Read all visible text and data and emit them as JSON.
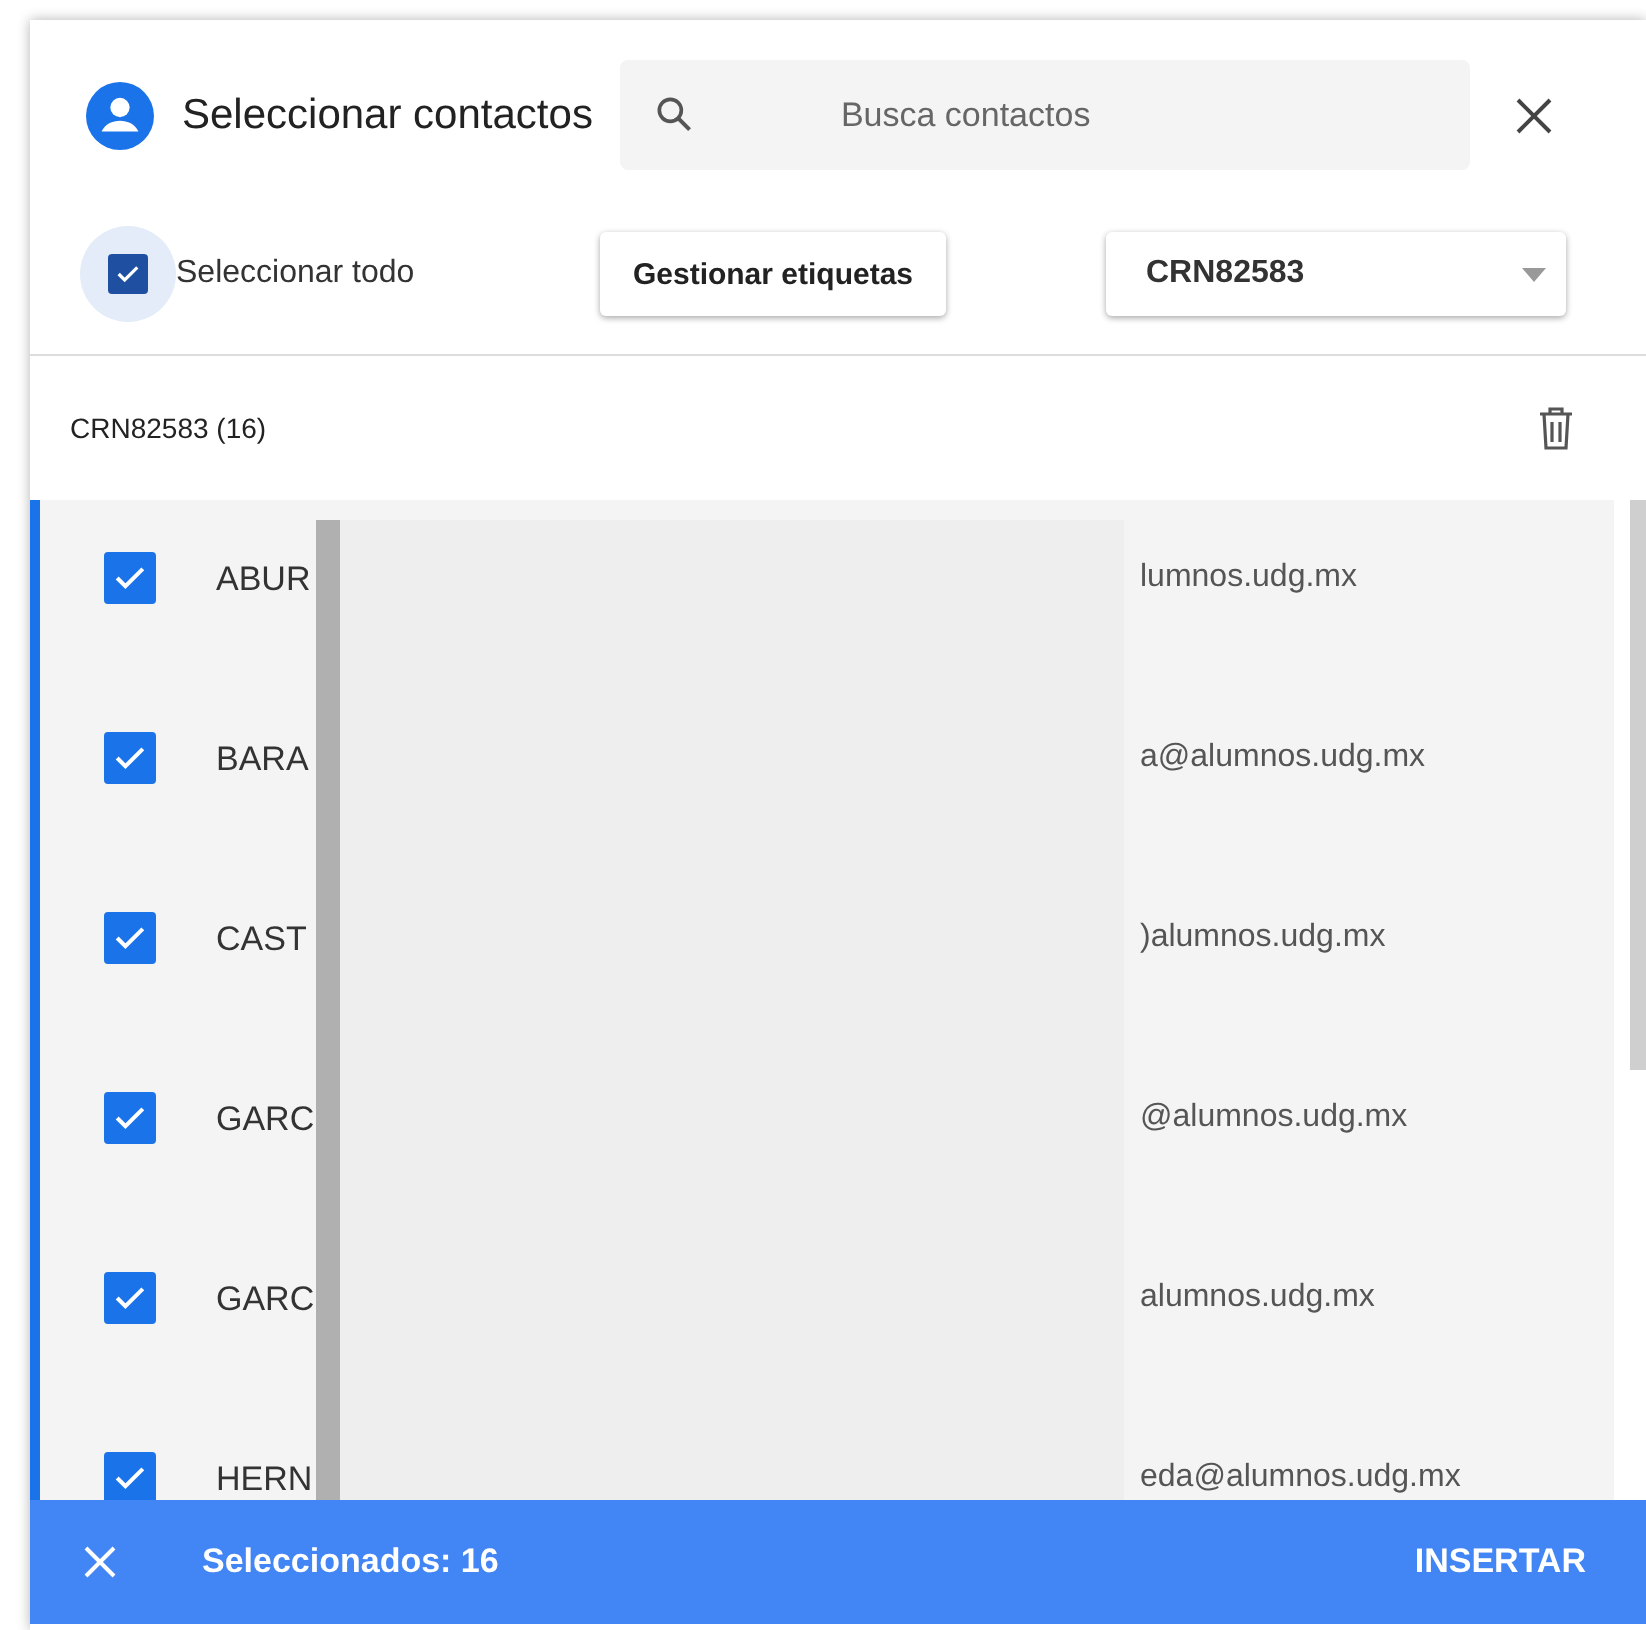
{
  "dialog": {
    "title": "Seleccionar contactos",
    "search": {
      "placeholder": "Busca contactos"
    }
  },
  "toolbar": {
    "select_all": {
      "label": "Seleccionar todo",
      "checked": true
    },
    "manage_labels": "Gestionar etiquetas",
    "label_select": "CRN82583"
  },
  "group": {
    "title": "CRN82583 (16)"
  },
  "contacts": [
    {
      "name": "ABUR",
      "email": "lumnos.udg.mx",
      "checked": true
    },
    {
      "name": "BARA",
      "email": "a@alumnos.udg.mx",
      "checked": true
    },
    {
      "name": "CAST",
      "email": ")alumnos.udg.mx",
      "checked": true
    },
    {
      "name": "GARC",
      "email": "@alumnos.udg.mx",
      "checked": true
    },
    {
      "name": "GARC",
      "email": "alumnos.udg.mx",
      "checked": true
    },
    {
      "name": "HERN",
      "email": "eda@alumnos.udg.mx",
      "checked": true
    }
  ],
  "footer": {
    "count": "Seleccionados: 16",
    "action": "INSERTAR"
  }
}
